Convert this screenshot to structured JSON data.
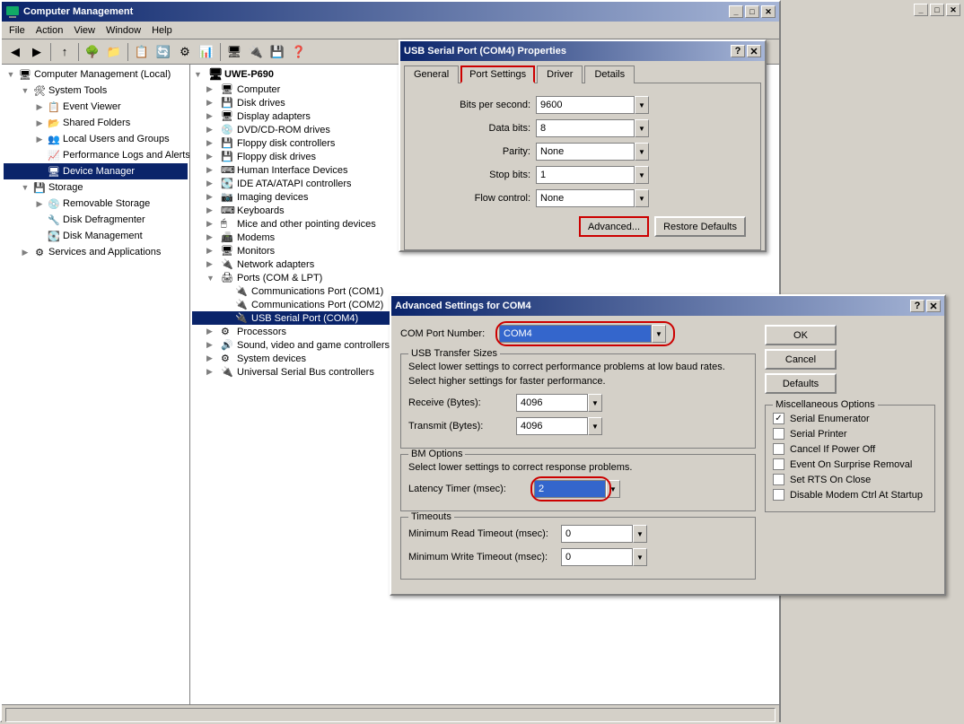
{
  "mainWindow": {
    "title": "Computer Management",
    "menuItems": [
      "File",
      "Action",
      "View",
      "Window",
      "Help"
    ]
  },
  "leftTree": {
    "items": [
      {
        "id": "comp-mgmt",
        "label": "Computer Management (Local)",
        "level": 0,
        "expanded": true,
        "icon": "computer"
      },
      {
        "id": "sys-tools",
        "label": "System Tools",
        "level": 1,
        "expanded": true,
        "icon": "folder"
      },
      {
        "id": "event-viewer",
        "label": "Event Viewer",
        "level": 2,
        "expanded": false,
        "icon": "event"
      },
      {
        "id": "shared-folders",
        "label": "Shared Folders",
        "level": 2,
        "expanded": false,
        "icon": "folder"
      },
      {
        "id": "local-users",
        "label": "Local Users and Groups",
        "level": 2,
        "expanded": false,
        "icon": "users"
      },
      {
        "id": "perf-logs",
        "label": "Performance Logs and Alerts",
        "level": 2,
        "expanded": false,
        "icon": "perf"
      },
      {
        "id": "device-mgr",
        "label": "Device Manager",
        "level": 2,
        "expanded": false,
        "icon": "device",
        "selected": true
      },
      {
        "id": "storage",
        "label": "Storage",
        "level": 1,
        "expanded": true,
        "icon": "storage"
      },
      {
        "id": "removable",
        "label": "Removable Storage",
        "level": 2,
        "expanded": false,
        "icon": "removable"
      },
      {
        "id": "disk-defrag",
        "label": "Disk Defragmenter",
        "level": 2,
        "expanded": false,
        "icon": "defrag"
      },
      {
        "id": "disk-mgmt",
        "label": "Disk Management",
        "level": 2,
        "expanded": false,
        "icon": "disk"
      },
      {
        "id": "services",
        "label": "Services and Applications",
        "level": 1,
        "expanded": false,
        "icon": "services"
      }
    ]
  },
  "rightPane": {
    "header": "UWE-P690",
    "devices": [
      {
        "id": "computer",
        "label": "Computer",
        "level": 0,
        "expanded": true
      },
      {
        "id": "disk-drives",
        "label": "Disk drives",
        "level": 1,
        "expanded": false
      },
      {
        "id": "display-adapters",
        "label": "Display adapters",
        "level": 1,
        "expanded": false
      },
      {
        "id": "dvd-rom",
        "label": "DVD/CD-ROM drives",
        "level": 1,
        "expanded": false
      },
      {
        "id": "floppy-ctrl",
        "label": "Floppy disk controllers",
        "level": 1,
        "expanded": false
      },
      {
        "id": "floppy-drives",
        "label": "Floppy disk drives",
        "level": 1,
        "expanded": false
      },
      {
        "id": "hid",
        "label": "Human Interface Devices",
        "level": 1,
        "expanded": false
      },
      {
        "id": "ide-ata",
        "label": "IDE ATA/ATAPI controllers",
        "level": 1,
        "expanded": false
      },
      {
        "id": "imaging",
        "label": "Imaging devices",
        "level": 1,
        "expanded": false
      },
      {
        "id": "keyboards",
        "label": "Keyboards",
        "level": 1,
        "expanded": false
      },
      {
        "id": "mice",
        "label": "Mice and other pointing devices",
        "level": 1,
        "expanded": false
      },
      {
        "id": "modems",
        "label": "Modems",
        "level": 1,
        "expanded": false
      },
      {
        "id": "monitors",
        "label": "Monitors",
        "level": 1,
        "expanded": false
      },
      {
        "id": "network",
        "label": "Network adapters",
        "level": 1,
        "expanded": false
      },
      {
        "id": "ports",
        "label": "Ports (COM & LPT)",
        "level": 1,
        "expanded": true
      },
      {
        "id": "com1",
        "label": "Communications Port (COM1)",
        "level": 2,
        "expanded": false
      },
      {
        "id": "com2",
        "label": "Communications Port (COM2)",
        "level": 2,
        "expanded": false
      },
      {
        "id": "com4",
        "label": "USB Serial Port (COM4)",
        "level": 2,
        "expanded": false,
        "selected": true
      },
      {
        "id": "processors",
        "label": "Processors",
        "level": 1,
        "expanded": false
      },
      {
        "id": "sound",
        "label": "Sound, video and game controllers",
        "level": 1,
        "expanded": false
      },
      {
        "id": "system-dev",
        "label": "System devices",
        "level": 1,
        "expanded": false
      },
      {
        "id": "usb-ctrl",
        "label": "Universal Serial Bus controllers",
        "level": 1,
        "expanded": false
      }
    ]
  },
  "usbPropertiesDialog": {
    "title": "USB Serial Port (COM4) Properties",
    "tabs": [
      "General",
      "Port Settings",
      "Driver",
      "Details"
    ],
    "activeTab": "Port Settings",
    "fields": {
      "bitsPerSecond": {
        "label": "Bits per second:",
        "value": "9600"
      },
      "dataBits": {
        "label": "Data bits:",
        "value": "8"
      },
      "parity": {
        "label": "Parity:",
        "value": "None"
      },
      "stopBits": {
        "label": "Stop bits:",
        "value": "1"
      },
      "flowControl": {
        "label": "Flow control:",
        "value": "None"
      }
    },
    "buttons": {
      "advanced": "Advanced...",
      "restoreDefaults": "Restore Defaults"
    }
  },
  "advancedDialog": {
    "title": "Advanced Settings for COM4",
    "comPortLabel": "COM Port Number:",
    "comPortValue": "COM4",
    "usbTransferTitle": "USB Transfer Sizes",
    "usbTransferDesc1": "Select lower settings to correct performance problems at low baud rates.",
    "usbTransferDesc2": "Select higher settings for faster performance.",
    "receiveLabel": "Receive (Bytes):",
    "receiveValue": "4096",
    "transmitLabel": "Transmit (Bytes):",
    "transmitValue": "4096",
    "bmOptionsTitle": "BM Options",
    "bmOptionsDesc": "Select lower settings to correct response problems.",
    "latencyLabel": "Latency Timer (msec):",
    "latencyValue": "2",
    "timeoutsTitle": "Timeouts",
    "minReadLabel": "Minimum Read Timeout (msec):",
    "minReadValue": "0",
    "minWriteLabel": "Minimum Write Timeout (msec):",
    "minWriteValue": "0",
    "miscTitle": "Miscellaneous Options",
    "miscOptions": [
      {
        "label": "Serial Enumerator",
        "checked": true
      },
      {
        "label": "Serial Printer",
        "checked": false
      },
      {
        "label": "Cancel If Power Off",
        "checked": false
      },
      {
        "label": "Event On Surprise Removal",
        "checked": false
      },
      {
        "label": "Set RTS On Close",
        "checked": false
      },
      {
        "label": "Disable Modem Ctrl At Startup",
        "checked": false
      }
    ],
    "buttons": {
      "ok": "OK",
      "cancel": "Cancel",
      "defaults": "Defaults"
    }
  },
  "statusBar": {
    "text": ""
  }
}
